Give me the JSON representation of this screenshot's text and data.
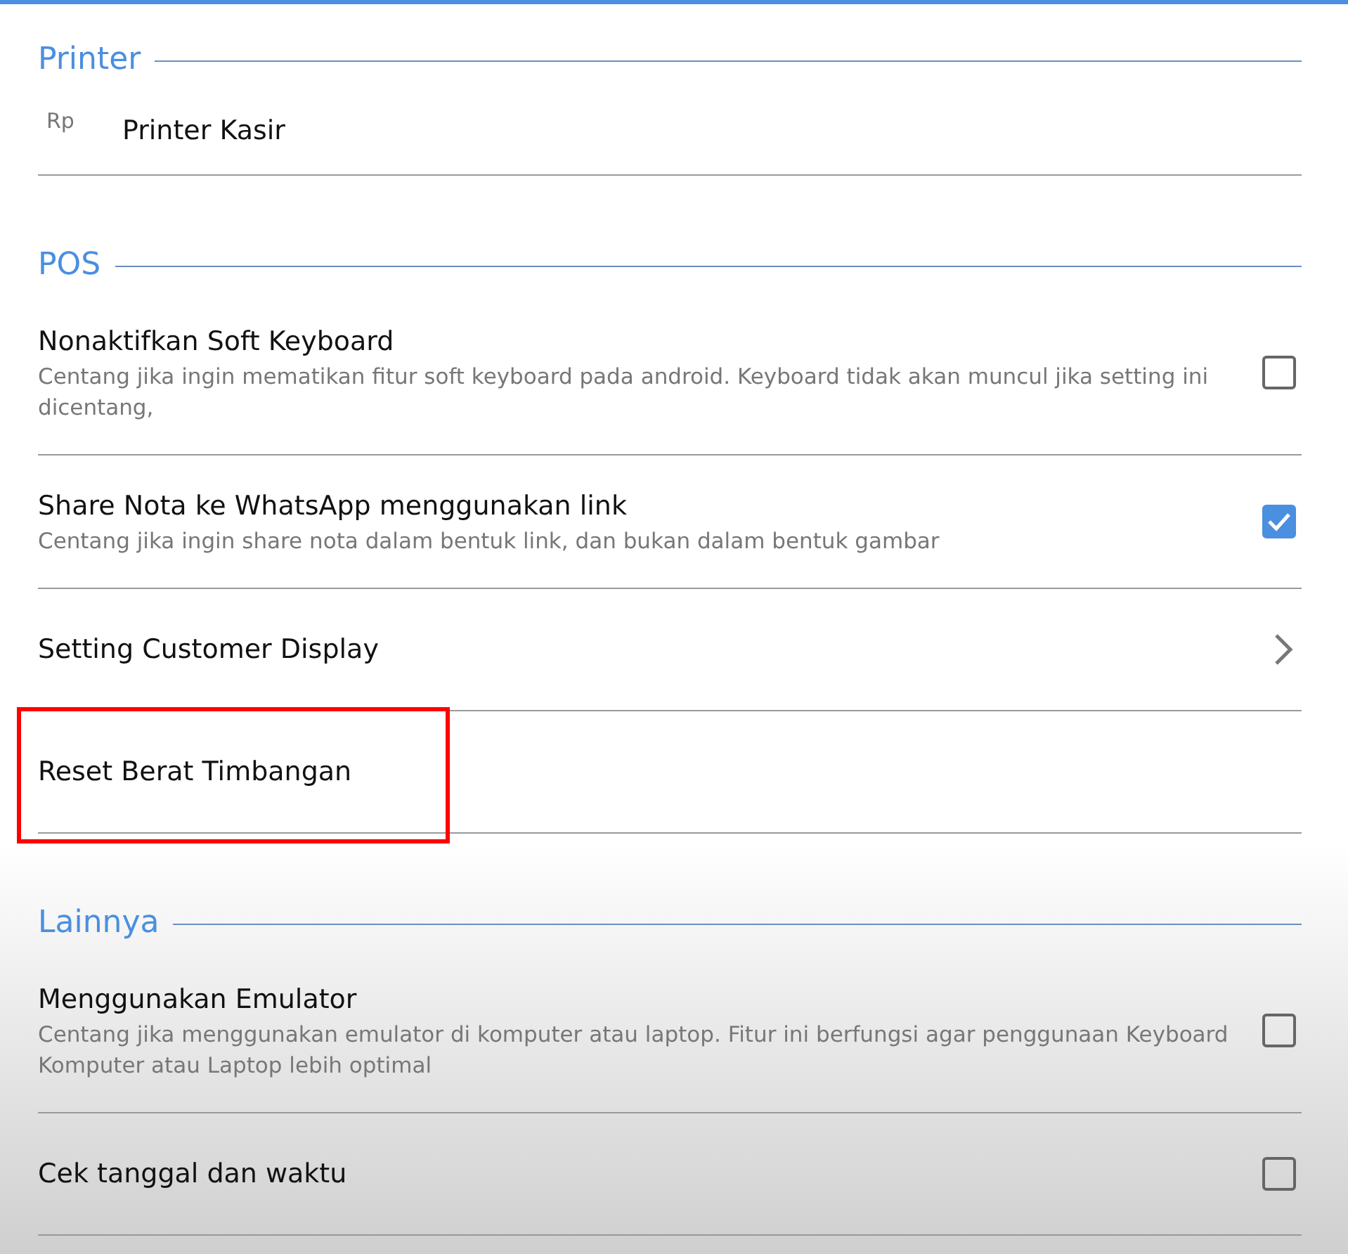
{
  "sections": [
    {
      "title": "Printer",
      "items": [
        {
          "kind": "icon",
          "icon_text": "Rp",
          "title": "Printer Kasir"
        }
      ]
    },
    {
      "title": "POS",
      "items": [
        {
          "kind": "checkbox",
          "title": "Nonaktifkan Soft Keyboard",
          "description": "Centang jika ingin mematikan fitur soft keyboard pada android. Keyboard tidak akan muncul jika setting ini dicentang,",
          "checked": false
        },
        {
          "kind": "checkbox",
          "title": "Share Nota ke WhatsApp menggunakan link",
          "description": "Centang jika ingin share nota dalam bentuk link, dan bukan dalam bentuk gambar",
          "checked": true
        },
        {
          "kind": "chevron",
          "title": "Setting Customer Display"
        },
        {
          "kind": "plain",
          "title": "Reset Berat Timbangan",
          "highlighted": true
        }
      ]
    },
    {
      "title": "Lainnya",
      "items": [
        {
          "kind": "checkbox",
          "title": "Menggunakan Emulator",
          "description": "Centang jika menggunakan emulator di komputer atau laptop. Fitur ini berfungsi agar penggunaan Keyboard Komputer atau Laptop lebih optimal",
          "checked": false
        },
        {
          "kind": "checkbox",
          "title": "Cek tanggal dan waktu",
          "checked": false
        }
      ]
    }
  ]
}
